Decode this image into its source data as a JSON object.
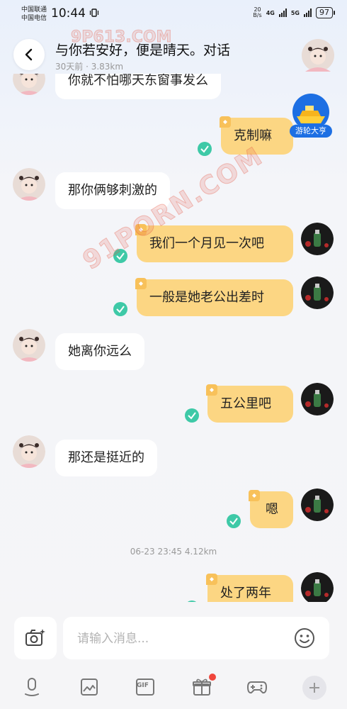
{
  "status_bar": {
    "carrier_1": "中国联通",
    "carrier_2": "中国电信",
    "time": "10:44",
    "speed_value": "20",
    "speed_unit": "B/s",
    "network_1": "4G",
    "network_2": "5G",
    "battery": "97"
  },
  "header": {
    "title": "与你若安好，便是晴天。对话",
    "subtitle": "30天前 · 3.83km",
    "back_icon": "chevron-left-icon"
  },
  "badge": {
    "label": "游轮大亨"
  },
  "watermarks": {
    "large": "91PORN.COM",
    "small": "9P613.COM"
  },
  "messages": [
    {
      "side": "left",
      "text": "你就不怕哪天东窗事发么",
      "read": false
    },
    {
      "side": "right",
      "text": "克制嘛",
      "read": true
    },
    {
      "side": "left",
      "text": "那你俩够刺激的",
      "read": false
    },
    {
      "side": "right",
      "text": "我们一个月见一次吧",
      "read": true
    },
    {
      "side": "right",
      "text": "一般是她老公出差时",
      "read": true
    },
    {
      "side": "left",
      "text": "她离你远么",
      "read": false
    },
    {
      "side": "right",
      "text": "五公里吧",
      "read": true
    },
    {
      "side": "left",
      "text": "那还是挺近的",
      "read": false
    },
    {
      "side": "right",
      "text": "嗯",
      "read": true
    },
    {
      "side": "timestamp",
      "text": "06-23 23:45  4.12km"
    },
    {
      "side": "right",
      "text": "处了两年",
      "read": true
    }
  ],
  "input": {
    "placeholder": "请输入消息...",
    "value": ""
  },
  "toolbar": {
    "items": [
      "microphone-icon",
      "image-icon",
      "gif-icon",
      "gift-icon",
      "gamepad-icon",
      "plus-icon"
    ],
    "gif_label": "GIF"
  },
  "colors": {
    "self_bubble": "#fcd683",
    "other_bubble": "#ffffff",
    "read_check": "#3ec9a7",
    "badge_blue": "#1d6fe3",
    "notification_dot": "#f0463c"
  }
}
